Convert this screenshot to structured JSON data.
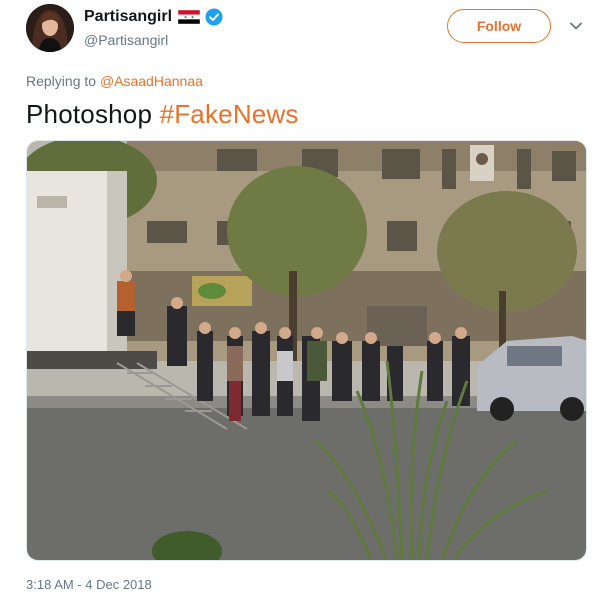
{
  "author": {
    "display_name": "Partisangirl",
    "handle": "@Partisangirl",
    "flag_icon": "syria-flag-icon",
    "verified_icon": "verified-badge-icon",
    "verified_color": "#1da1f2"
  },
  "actions": {
    "follow_label": "Follow",
    "menu_icon": "chevron-down-icon"
  },
  "reply": {
    "prefix": "Replying to ",
    "mention": "@AsaadHannaa"
  },
  "tweet": {
    "text": "Photoshop ",
    "hashtag": "#FakeNews",
    "timestamp": "3:18 AM - 4 Dec 2018"
  },
  "theme": {
    "accent": "#e5732b",
    "text_primary": "#14171a",
    "text_secondary": "#657786"
  }
}
